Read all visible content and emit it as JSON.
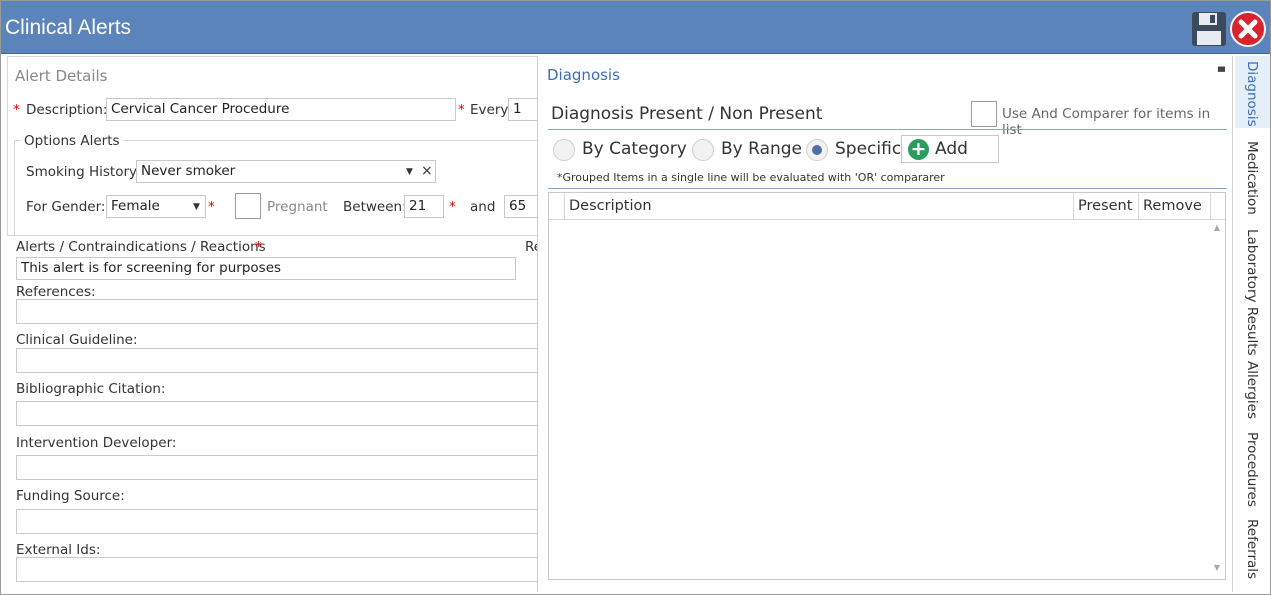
{
  "window": {
    "title": "Clinical Alerts"
  },
  "left": {
    "section_title": "Alert Details",
    "required_mark": "*",
    "description": {
      "label": "Description:",
      "value": "Cervical Cancer Procedure"
    },
    "every": {
      "label": "Every:",
      "value": "1"
    },
    "options": {
      "title": "Options Alerts",
      "smoking": {
        "label": "Smoking History:",
        "value": "Never smoker",
        "clear": "×",
        "arrow": "▼"
      },
      "gender": {
        "label": "For Gender:",
        "value": "Female",
        "arrow": "▼"
      },
      "pregnant": {
        "label": "Pregnant"
      },
      "between": {
        "label": "Between:",
        "from": "21",
        "and_label": "and",
        "to": "65"
      }
    },
    "alerts": {
      "label": "Alerts / Contraindications / Reactions",
      "value": "This alert is for screening for purposes",
      "cut_label": "Re"
    },
    "references": {
      "label": "References:",
      "value": ""
    },
    "guideline": {
      "label": "Clinical Guideline:",
      "value": ""
    },
    "citation": {
      "label": "Bibliographic Citation:",
      "value": ""
    },
    "developer": {
      "label": "Intervention Developer:",
      "value": ""
    },
    "funding": {
      "label": "Funding Source:",
      "value": ""
    },
    "external": {
      "label": "External Ids:",
      "value": ""
    }
  },
  "diagnosis": {
    "title": "Diagnosis",
    "pin": "▀",
    "subtitle": "Diagnosis Present / Non Present",
    "use_and_label": "Use And Comparer for items in list",
    "radios": [
      {
        "label": "By Category",
        "selected": false
      },
      {
        "label": "By Range",
        "selected": false
      },
      {
        "label": "Specific",
        "selected": true
      }
    ],
    "add_label": "Add",
    "add_icon": "+",
    "note": "*Grouped Items in a single line will be evaluated with 'OR' compararer",
    "columns": [
      "Description",
      "Present",
      "Remove"
    ],
    "scroll_up": "▲",
    "scroll_down": "▼"
  },
  "tabs": [
    "Diagnosis",
    "Medication",
    "Laboratory Results",
    "Allergies",
    "Procedures",
    "Referrals"
  ],
  "colors": {
    "titlebar": "#5b84ba",
    "accent": "#3a6fb5",
    "required": "#dd0000",
    "add_green": "#2c9c5c",
    "close_red": "#d9232d"
  }
}
